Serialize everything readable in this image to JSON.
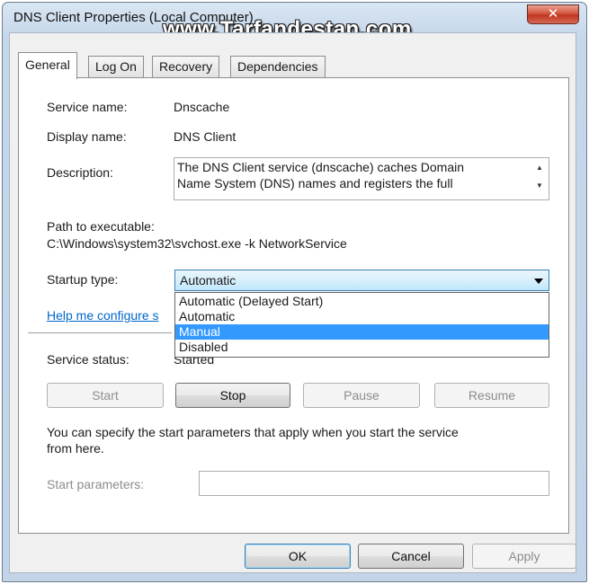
{
  "window": {
    "title": "DNS Client Properties (Local Computer)",
    "watermark": "www.Tarfandestan.com",
    "close_glyph": "✕"
  },
  "tabs": [
    "General",
    "Log On",
    "Recovery",
    "Dependencies"
  ],
  "general": {
    "service_name_label": "Service name:",
    "service_name_value": "Dnscache",
    "display_name_label": "Display name:",
    "display_name_value": "DNS Client",
    "description_label": "Description:",
    "description_value": "The DNS Client service (dnscache) caches Domain\nName System (DNS) names and registers the full",
    "path_label": "Path to executable:",
    "path_value": "C:\\Windows\\system32\\svchost.exe -k NetworkService",
    "startup_type_label": "Startup type:",
    "startup_type_value": "Automatic",
    "startup_options": [
      "Automatic (Delayed Start)",
      "Automatic",
      "Manual",
      "Disabled"
    ],
    "highlighted_option": "Manual",
    "help_link": "Help me configure s",
    "service_status_label": "Service status:",
    "service_status_value": "Started",
    "buttons": {
      "start": "Start",
      "stop": "Stop",
      "pause": "Pause",
      "resume": "Resume"
    },
    "hint_line1": "You can specify the start parameters that apply when you start the service",
    "hint_line2": "from here.",
    "start_params_label": "Start parameters:",
    "start_params_value": ""
  },
  "footer": {
    "ok": "OK",
    "cancel": "Cancel",
    "apply": "Apply"
  },
  "colors": {
    "selection": "#3399ff",
    "link": "#0066cc",
    "close": "#c0351f"
  }
}
